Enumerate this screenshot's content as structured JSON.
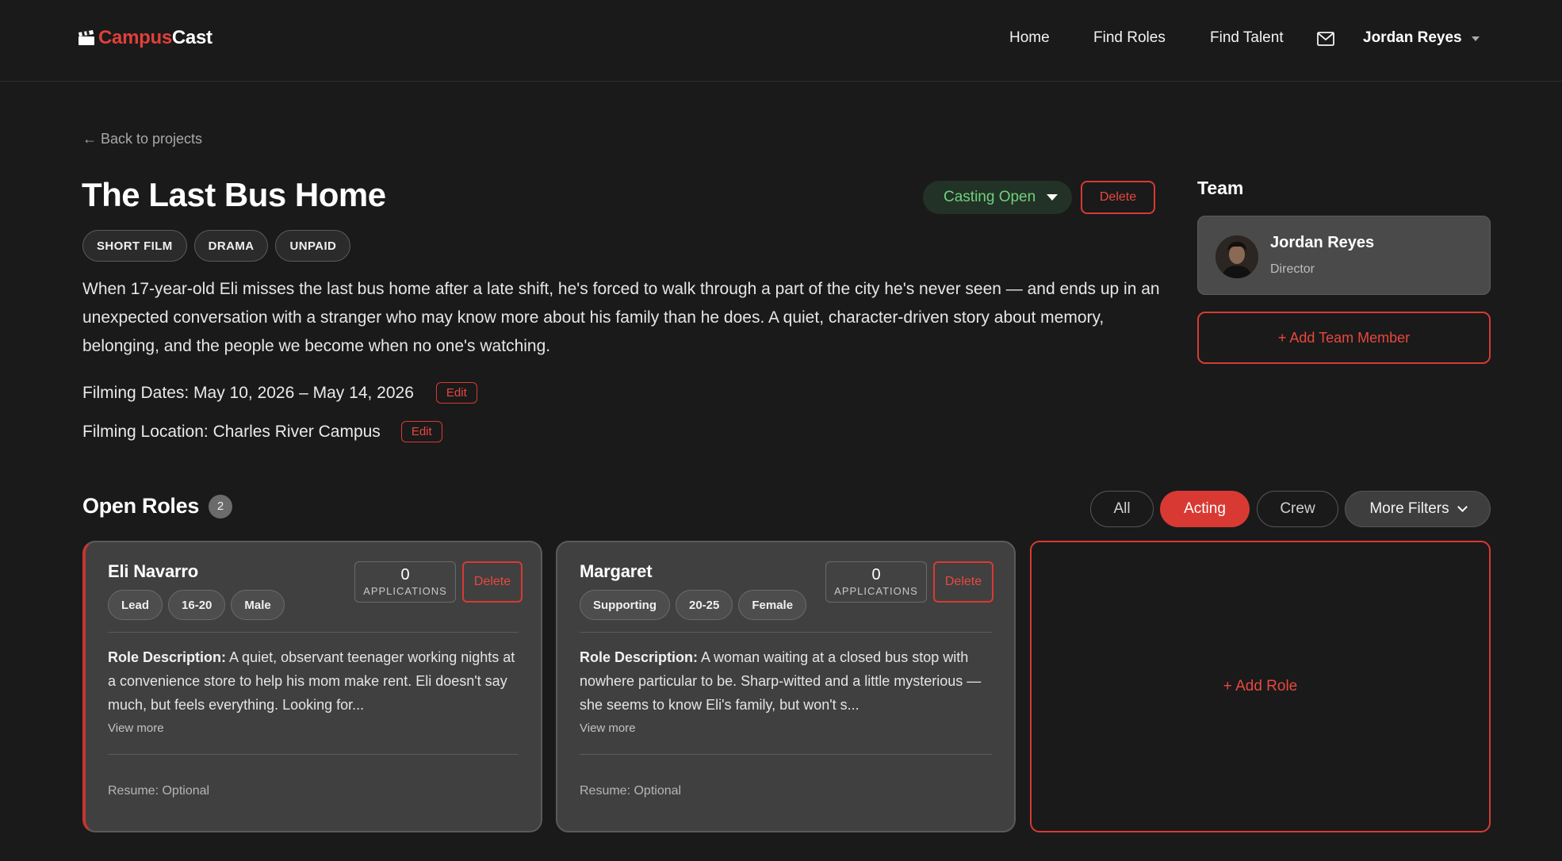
{
  "app": {
    "logo_part1": "Campus",
    "logo_part2": "Cast",
    "accent": "#d83a33",
    "logo_icon": "clapperboard-icon"
  },
  "nav": {
    "home": "Home",
    "find_roles": "Find Roles",
    "find_talent": "Find Talent",
    "mail_icon": "mail-icon",
    "user_name": "Jordan Reyes"
  },
  "page": {
    "back_label": "← Back to projects",
    "title": "The Last Bus Home",
    "status": "Casting Open",
    "status_color": "#6fd07e",
    "delete_label": "Delete",
    "tags": [
      "SHORT FILM",
      "DRAMA",
      "UNPAID"
    ],
    "description": "When 17-year-old Eli misses the last bus home after a late shift, he's forced to walk through a part of the city he's never seen — and ends up in an unexpected conversation with a stranger who may know more about his family than he does. A quiet, character-driven story about memory, belonging, and the people we become when no one's watching.",
    "filming_dates": "Filming Dates: May 10, 2026 – May 14, 2026",
    "filming_location": "Filming Location: Charles River Campus",
    "edit_label": "Edit"
  },
  "team": {
    "title": "Team",
    "members": [
      {
        "name": "Jordan Reyes",
        "role": "Director"
      }
    ],
    "add_label": "+ Add Team Member"
  },
  "roles": {
    "title": "Open Roles",
    "count": "2",
    "filters": [
      "All",
      "Acting",
      "Crew",
      "More Filters"
    ],
    "active_filter": "Acting",
    "applications_label": "APPLICATIONS",
    "delete_label": "Delete",
    "description_label": "Role Description:",
    "view_more_label": "View more",
    "add_role_label": "+ Add Role",
    "items": [
      {
        "name": "Eli Navarro",
        "tags": [
          "Lead",
          "16-20",
          "Male"
        ],
        "applications": "0",
        "description": "A quiet, observant teenager working nights at a convenience store to help his mom make rent. Eli doesn't say much, but feels everything. Looking for...",
        "resume": "Resume: Optional"
      },
      {
        "name": "Margaret",
        "tags": [
          "Supporting",
          "20-25",
          "Female"
        ],
        "applications": "0",
        "description": "A woman waiting at a closed bus stop with nowhere particular to be. Sharp-witted and a little mysterious — she seems to know Eli's family, but won't s...",
        "resume": "Resume: Optional"
      }
    ]
  }
}
